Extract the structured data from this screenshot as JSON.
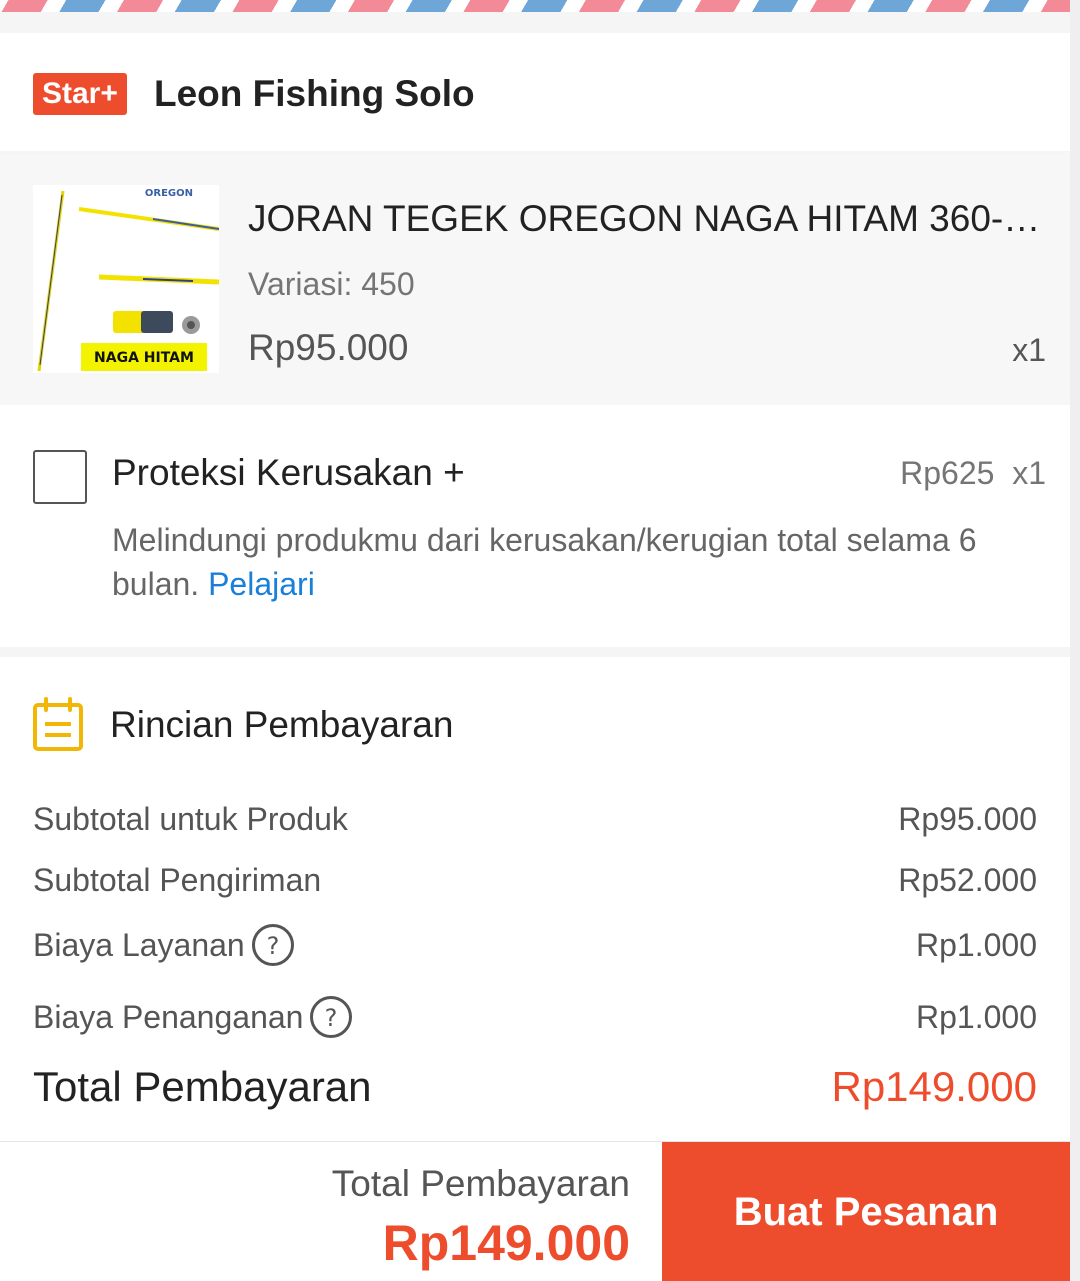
{
  "shop": {
    "badge": "Star+",
    "name": "Leon Fishing Solo"
  },
  "product": {
    "name": "JORAN TEGEK OREGON NAGA HITAM 360-4...",
    "variation": "Variasi: 450",
    "price": "Rp95.000",
    "qty": "x1",
    "image_brand": "OREGON",
    "image_label": "NAGA HITAM"
  },
  "protection": {
    "title": "Proteksi Kerusakan +",
    "price": "Rp625  x1",
    "description": "Melindungi produkmu dari kerusakan/kerugian total selama 6 bulan. ",
    "link": "Pelajari",
    "checked": false
  },
  "payment": {
    "title": "Rincian Pembayaran",
    "icon": "receipt-icon",
    "rows": [
      {
        "label": "Subtotal untuk Produk",
        "value": "Rp95.000"
      },
      {
        "label": "Subtotal Pengiriman",
        "value": "Rp52.000"
      },
      {
        "label": "Biaya Layanan",
        "value": "Rp1.000"
      },
      {
        "label": "Biaya Penanganan",
        "value": "Rp1.000"
      }
    ],
    "total_label": "Total Pembayaran",
    "total_value": "Rp149.000"
  },
  "bottom_bar": {
    "total_label": "Total Pembayaran",
    "total_value": "Rp149.000",
    "order_button": "Buat Pesanan"
  },
  "colors": {
    "accent": "#ee4d2d",
    "link": "#1a7fd8",
    "icon_yellow": "#f2b705"
  }
}
